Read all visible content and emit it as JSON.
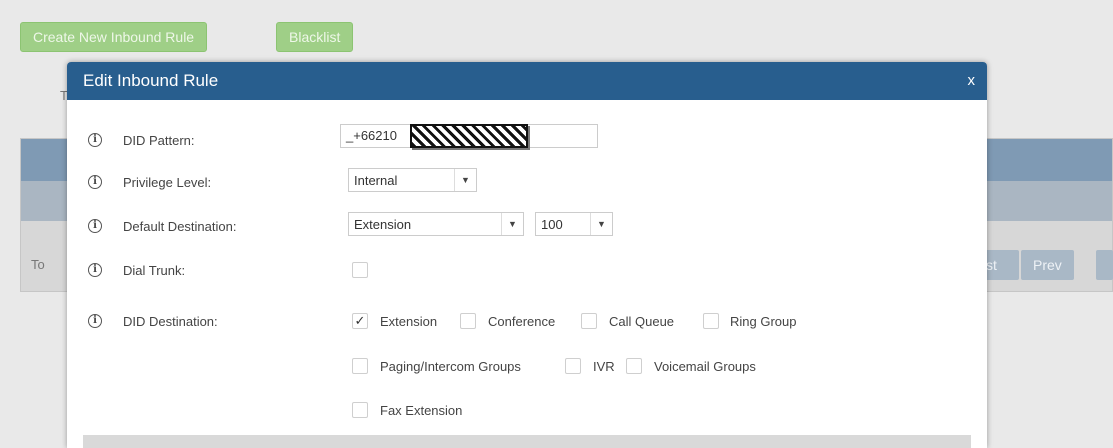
{
  "background": {
    "create_button": "Create New Inbound Rule",
    "blacklist_button": "Blacklist",
    "text_t": "T",
    "text_to": "To",
    "pager_first": "st",
    "pager_prev": "Prev"
  },
  "modal": {
    "title": "Edit Inbound Rule",
    "close": "x",
    "fields": {
      "did_pattern": {
        "label": "DID Pattern:",
        "value": "_+66210"
      },
      "privilege_level": {
        "label": "Privilege Level:",
        "value": "Internal"
      },
      "default_destination": {
        "label": "Default Destination:",
        "value": "Extension",
        "value2": "100"
      },
      "dial_trunk": {
        "label": "Dial Trunk:"
      },
      "did_destination": {
        "label": "DID Destination:",
        "options": [
          {
            "label": "Extension",
            "checked": true
          },
          {
            "label": "Conference",
            "checked": false
          },
          {
            "label": "Call Queue",
            "checked": false
          },
          {
            "label": "Ring Group",
            "checked": false
          },
          {
            "label": "Paging/Intercom Groups",
            "checked": false
          },
          {
            "label": "IVR",
            "checked": false
          },
          {
            "label": "Voicemail Groups",
            "checked": false
          },
          {
            "label": "Fax Extension",
            "checked": false
          }
        ]
      }
    },
    "icons": {
      "info": "i",
      "dropdown": "▼",
      "check": "✓"
    }
  },
  "colors": {
    "header": "#285e8e",
    "green_button": "#9fcf87"
  }
}
